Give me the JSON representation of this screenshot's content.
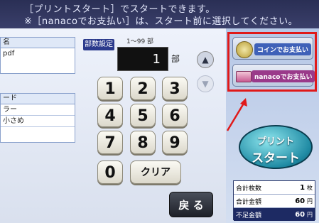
{
  "banner": {
    "line1": "［プリントスタート］でスタートできます。",
    "line2": "※［nanacoでお支払い］は、スタート前に選択してください。"
  },
  "left_panel": {
    "file_header": "名",
    "file_value": "pdf",
    "mode_header": "ード",
    "mode_value": "ラー",
    "size_value": "小さめ"
  },
  "copies": {
    "label": "部数設定",
    "range": "1〜99 部",
    "value": "1",
    "unit": "部"
  },
  "keypad": {
    "keys": [
      "1",
      "2",
      "3",
      "4",
      "5",
      "6",
      "7",
      "8",
      "9",
      "0"
    ],
    "clear": "クリア"
  },
  "back_label": "戻 る",
  "payment": {
    "coin_label": "コインでお支払い",
    "nanaco_label": "nanacoでお支払い"
  },
  "print_start": {
    "line1": "プリント",
    "line2": "スタート"
  },
  "summary": {
    "sheets_label": "合計枚数",
    "sheets_value": "1",
    "sheets_unit": "枚",
    "total_label": "合計金額",
    "total_value": "60",
    "total_unit": "円",
    "shortage_label": "不足金額",
    "shortage_value": "60",
    "shortage_unit": "円"
  },
  "colors": {
    "highlight": "#e01919",
    "accent": "#2b3a8c"
  }
}
